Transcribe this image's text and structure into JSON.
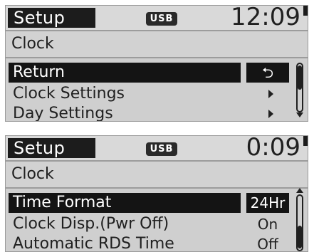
{
  "screens": [
    {
      "header": {
        "title": "Setup",
        "usb_badge": "USB",
        "time": "12:09"
      },
      "subtitle": "Clock",
      "items": [
        {
          "label": "Return",
          "value": "⮌"
        },
        {
          "label": "Clock Settings"
        },
        {
          "label": "Day Settings"
        }
      ]
    },
    {
      "header": {
        "title": "Setup",
        "usb_badge": "USB",
        "time": "0:09"
      },
      "subtitle": "Clock",
      "items": [
        {
          "label": "Time Format",
          "value": "24Hr"
        },
        {
          "label": "Clock Disp.(Pwr Off)",
          "value": "On"
        },
        {
          "label": "Automatic RDS Time",
          "value": "Off"
        }
      ]
    }
  ]
}
